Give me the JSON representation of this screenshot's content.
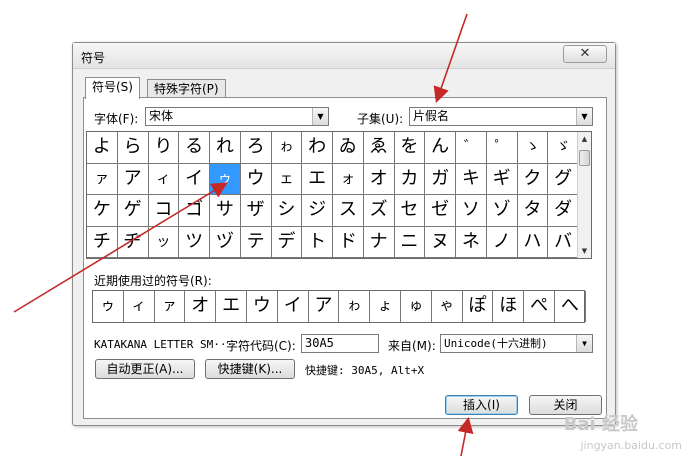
{
  "dialog": {
    "title": "符号",
    "close_glyph": "✕"
  },
  "tabs": [
    {
      "label": "符号(S)"
    },
    {
      "label": "特殊字符(P)"
    }
  ],
  "font": {
    "label": "字体(F):",
    "value": "宋体"
  },
  "subset": {
    "label": "子集(U):",
    "value": "片假名"
  },
  "grid": [
    [
      "よ",
      "ら",
      "り",
      "る",
      "れ",
      "ろ",
      "ゎ",
      "わ",
      "ゐ",
      "ゑ",
      "を",
      "ん",
      "゛",
      "゜",
      "ゝ",
      "ゞ"
    ],
    [
      "ァ",
      "ア",
      "ィ",
      "イ",
      "ゥ",
      "ウ",
      "ェ",
      "エ",
      "ォ",
      "オ",
      "カ",
      "ガ",
      "キ",
      "ギ",
      "ク",
      "グ"
    ],
    [
      "ケ",
      "ゲ",
      "コ",
      "ゴ",
      "サ",
      "ザ",
      "シ",
      "ジ",
      "ス",
      "ズ",
      "セ",
      "ゼ",
      "ソ",
      "ゾ",
      "タ",
      "ダ"
    ],
    [
      "チ",
      "ヂ",
      "ッ",
      "ツ",
      "ヅ",
      "テ",
      "デ",
      "ト",
      "ド",
      "ナ",
      "ニ",
      "ヌ",
      "ネ",
      "ノ",
      "ハ",
      "バ"
    ]
  ],
  "selected": {
    "row": 1,
    "col": 4
  },
  "recent": {
    "label": "近期使用过的符号(R):",
    "symbols": [
      "ゥ",
      "ィ",
      "ァ",
      "オ",
      "エ",
      "ウ",
      "イ",
      "ア",
      "ゎ",
      "ょ",
      "ゅ",
      "ゃ",
      "ぽ",
      "ほ",
      "ぺ",
      "へ"
    ]
  },
  "char_name": "KATAKANA LETTER SM···",
  "char_code": {
    "label": "字符代码(C):",
    "value": "30A5"
  },
  "from": {
    "label": "来自(M):",
    "value": "Unicode(十六进制)"
  },
  "buttons": {
    "autocorrect": "自动更正(A)...",
    "shortcut_key": "快捷键(K)...",
    "insert": "插入(I)",
    "close": "关闭"
  },
  "shortcut_info": "快捷键: 30A5, Alt+X",
  "watermark": {
    "brand": "Bai 经验",
    "url": "jingyan.baidu.com"
  },
  "colors": {
    "selection": "#3399ff",
    "arrow": "#c62828"
  }
}
